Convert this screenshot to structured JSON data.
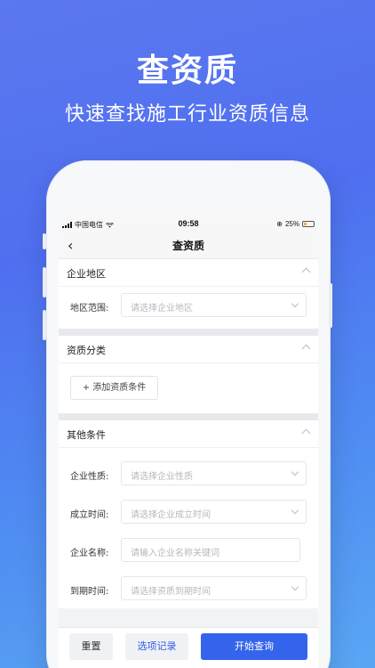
{
  "hero": {
    "title": "查资质",
    "subtitle": "快速查找施工行业资质信息"
  },
  "status_bar": {
    "carrier": "中国电信",
    "time": "09:58",
    "battery": "25%"
  },
  "nav": {
    "back_icon": "‹",
    "title": "查资质"
  },
  "sections": {
    "region": {
      "title": "企业地区",
      "field_label": "地区范围:",
      "placeholder": "请选择企业地区"
    },
    "qualification": {
      "title": "资质分类",
      "add_button": "+ 添加资质条件"
    },
    "other": {
      "title": "其他条件",
      "nature_label": "企业性质:",
      "nature_placeholder": "请选择企业性质",
      "founded_label": "成立时间:",
      "founded_placeholder": "请选择企业成立时间",
      "name_label": "企业名称:",
      "name_placeholder": "请输入企业名称关键词",
      "expiry_label": "到期时间:",
      "expiry_placeholder": "请选择资质到期时间"
    }
  },
  "actions": {
    "reset": "重置",
    "options": "选项记录",
    "search": "开始查询"
  },
  "colors": {
    "primary": "#3464ec",
    "background_gradient_start": "#5b78ee",
    "background_gradient_end": "#5aa6f4"
  }
}
